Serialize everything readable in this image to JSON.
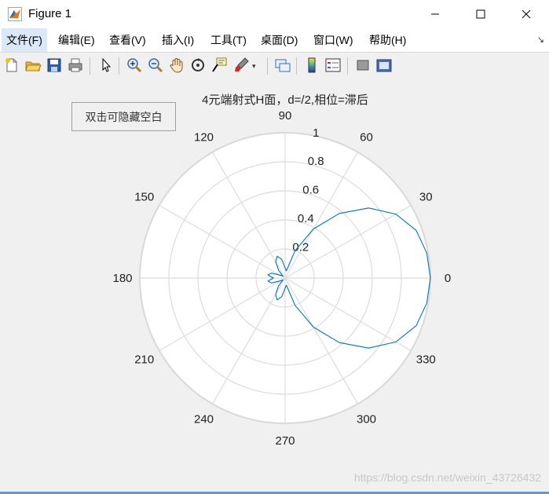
{
  "window": {
    "title": "Figure 1"
  },
  "menu": [
    {
      "label": "文件(F)"
    },
    {
      "label": "编辑(E)"
    },
    {
      "label": "查看(V)"
    },
    {
      "label": "插入(I)"
    },
    {
      "label": "工具(T)"
    },
    {
      "label": "桌面(D)"
    },
    {
      "label": "窗口(W)"
    },
    {
      "label": "帮助(H)"
    }
  ],
  "toolbar": {
    "icons": [
      "new-figure-icon",
      "open-folder-icon",
      "save-icon",
      "print-icon",
      "pointer-icon",
      "zoom-in-icon",
      "zoom-out-icon",
      "pan-hand-icon",
      "rotate-3d-icon",
      "data-cursor-icon",
      "brush-icon",
      "link-plot-icon",
      "colorbar-icon",
      "legend-icon",
      "hide-plot-tools-icon",
      "show-plot-tools-icon"
    ]
  },
  "overlay_button": {
    "label": "双击可隐藏空白"
  },
  "watermark": "https://blog.csdn.net/weixin_43726432",
  "chart_data": {
    "type": "line",
    "subtype": "polar",
    "title": "4元端射式H面，d=/2,相位=滞后",
    "theta_ticks": [
      "0",
      "30",
      "60",
      "90",
      "120",
      "150",
      "180",
      "210",
      "240",
      "270",
      "300",
      "330"
    ],
    "r_ticks": [
      "0.2",
      "0.4",
      "0.6",
      "0.8",
      "1"
    ],
    "rlim": [
      0,
      1
    ],
    "grid": true,
    "series": [
      {
        "color": "#0072bd",
        "theta_deg": [
          0,
          10,
          20,
          30,
          40,
          50,
          60,
          70,
          80,
          90,
          100,
          110,
          120,
          130,
          140,
          150,
          160,
          170,
          180,
          190,
          200,
          210,
          220,
          230,
          240,
          250,
          260,
          270,
          280,
          290,
          300,
          310,
          320,
          330,
          340,
          350,
          360
        ],
        "r": [
          1.0,
          0.99,
          0.96,
          0.88,
          0.75,
          0.58,
          0.39,
          0.2,
          0.05,
          0.07,
          0.13,
          0.16,
          0.13,
          0.07,
          0.02,
          0.04,
          0.1,
          0.12,
          0.08,
          0.12,
          0.1,
          0.04,
          0.02,
          0.07,
          0.13,
          0.16,
          0.13,
          0.07,
          0.05,
          0.2,
          0.39,
          0.58,
          0.75,
          0.88,
          0.96,
          0.99,
          1.0
        ]
      }
    ]
  }
}
